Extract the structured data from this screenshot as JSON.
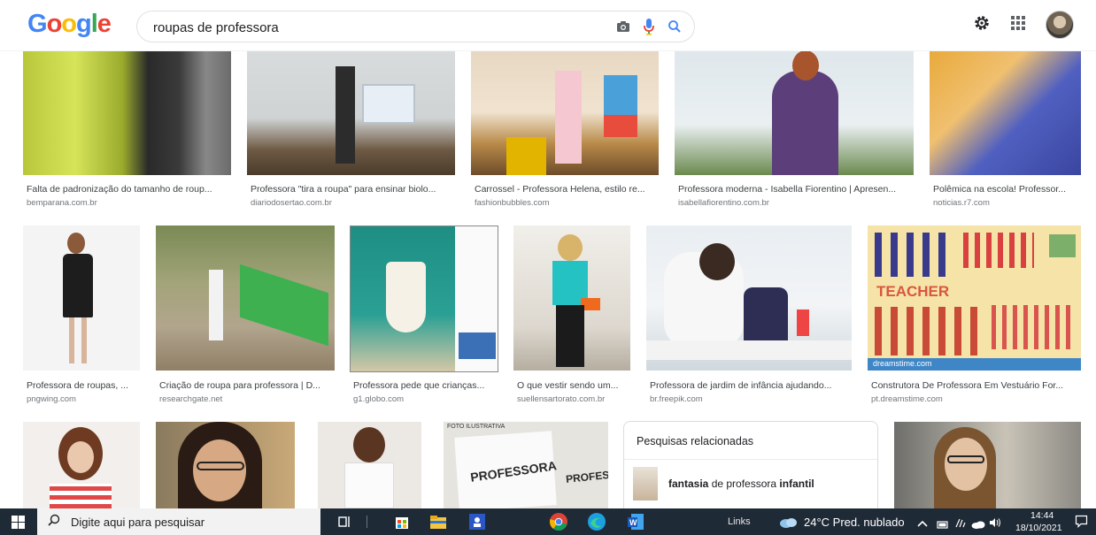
{
  "header": {
    "search_value": "roupas de professora",
    "logo_letters": [
      {
        "ch": "G",
        "color": "#4285F4"
      },
      {
        "ch": "o",
        "color": "#EA4335"
      },
      {
        "ch": "o",
        "color": "#FBBC05"
      },
      {
        "ch": "g",
        "color": "#4285F4"
      },
      {
        "ch": "l",
        "color": "#34A853"
      },
      {
        "ch": "e",
        "color": "#EA4335"
      }
    ]
  },
  "results": [
    {
      "caption": "Falta de padronização do tamanho de roup...",
      "source": "bemparana.com.br"
    },
    {
      "caption": "Professora \"tira a roupa\" para ensinar biolo...",
      "source": "diariodosertao.com.br"
    },
    {
      "caption": "Carrossel - Professora Helena, estilo re...",
      "source": "fashionbubbles.com"
    },
    {
      "caption": "Professora moderna - Isabella Fiorentino | Apresen...",
      "source": "isabellafiorentino.com.br"
    },
    {
      "caption": "Polêmica na escola! Professor...",
      "source": "noticias.r7.com"
    },
    {
      "caption": "Professora de roupas, ...",
      "source": "pngwing.com"
    },
    {
      "caption": "Criação de roupa para professora | D...",
      "source": "researchgate.net"
    },
    {
      "caption": "Professora pede que crianças...",
      "source": "g1.globo.com"
    },
    {
      "caption": "O que vestir sendo um...",
      "source": "suellensartorato.com.br"
    },
    {
      "caption": "Professora de jardim de infância ajudando...",
      "source": "br.freepik.com"
    },
    {
      "caption": "Construtora De Professora Em Vestuário For...",
      "source": "pt.dreamstime.com"
    }
  ],
  "image_text": {
    "teacher": "TEACHER",
    "dreamstime": "dreamstime.com",
    "professora": "PROFESSORA",
    "foto": "FOTO ILUSTRATIVA",
    "prof_short": "PROFESS"
  },
  "related": {
    "title": "Pesquisas relacionadas",
    "item_bold1": "fantasia",
    "item_mid": " de professora ",
    "item_bold2": "infantil"
  },
  "taskbar": {
    "search_placeholder": "Digite aqui para pesquisar",
    "links": "Links",
    "weather": "24°C  Pred. nublado",
    "time": "14:44",
    "date": "18/10/2021"
  }
}
